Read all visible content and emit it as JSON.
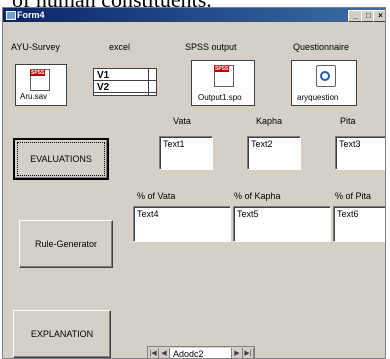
{
  "caption": "of human constituents.",
  "window": {
    "title": "Form4",
    "min": "_",
    "max": "□",
    "close": "×"
  },
  "headers": {
    "ayu_survey": "AYU-Survey",
    "excel": "excel",
    "spss_output": "SPSS output",
    "questionnaire": "Questionnaire"
  },
  "icons": {
    "aru_sav": {
      "tag": "SPSS",
      "caption": "Aru.sav"
    },
    "output": {
      "tag": "SPSS",
      "caption": "Output1.spo"
    },
    "questionnaire": {
      "caption": "aryquestion"
    }
  },
  "grid": {
    "rows": [
      "V1",
      "V2"
    ]
  },
  "dosha_labels": {
    "vata": "Vata",
    "kapha": "Kapha",
    "pita": "Pita"
  },
  "percent_labels": {
    "vata": "% of Vata",
    "kapha": "% of Kapha",
    "pita": "% of Pita"
  },
  "textboxes": [
    "Text1",
    "Text2",
    "Text3",
    "Text4",
    "Text5",
    "Text6"
  ],
  "buttons": {
    "evaluations": "EVALUATIONS",
    "rule_generator": "Rule-Generator",
    "explanation": "EXPLANATION"
  },
  "adodc": {
    "caption": "Adodc2",
    "first": "|◀",
    "prev": "◀",
    "next": "▶",
    "last": "▶|"
  }
}
